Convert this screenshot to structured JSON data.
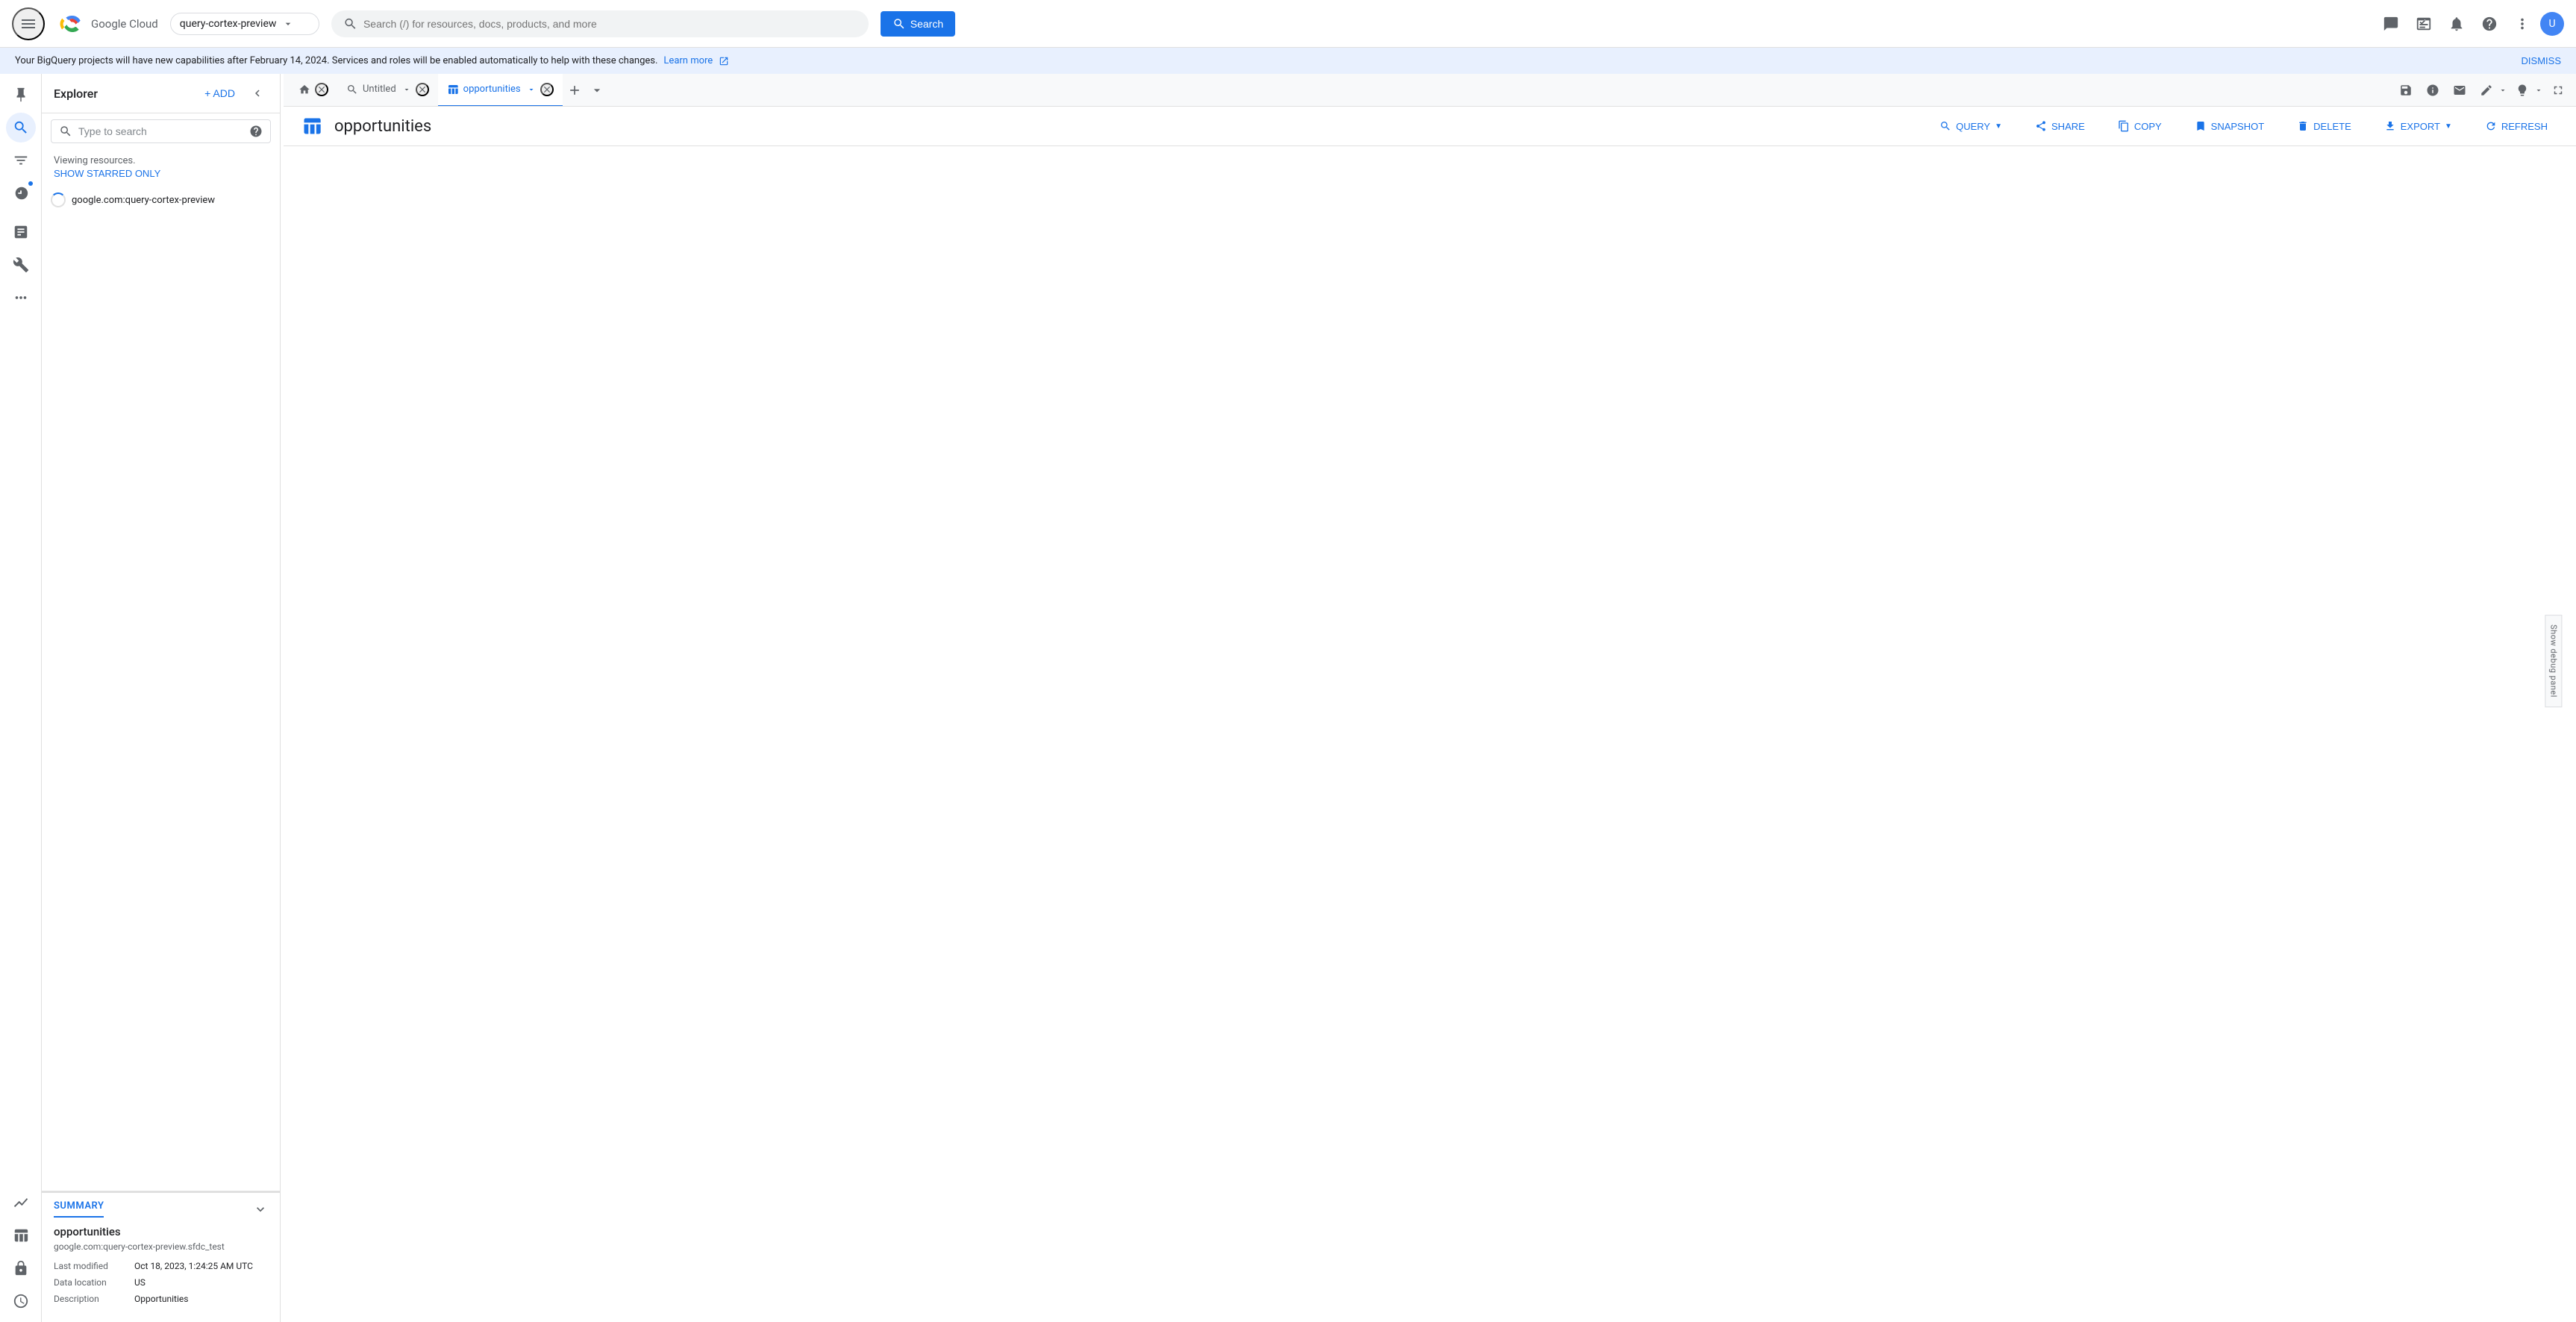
{
  "topbar": {
    "project_name": "query-cortex-preview",
    "search_placeholder": "Search (/) for resources, docs, products, and more",
    "search_button_label": "Search"
  },
  "notification": {
    "message": "Your BigQuery projects will have new capabilities after February 14, 2024. Services and roles will be enabled automatically to help with these changes.",
    "link_text": "Learn more",
    "dismiss_label": "DISMISS"
  },
  "explorer": {
    "title": "Explorer",
    "add_label": "+ ADD",
    "search_placeholder": "Type to search",
    "viewing_resources": "Viewing resources.",
    "show_starred_label": "SHOW STARRED ONLY",
    "resource_name": "google.com:query-cortex-preview"
  },
  "summary": {
    "tab_label": "SUMMARY",
    "table_name": "opportunities",
    "table_path": "google.com:query-cortex-preview.sfdc_test",
    "last_modified_label": "Last modified",
    "last_modified_value": "Oct 18, 2023, 1:24:25 AM UTC",
    "data_location_label": "Data location",
    "data_location_value": "US",
    "description_label": "Description",
    "description_value": "Opportunities"
  },
  "tabs": [
    {
      "id": "home",
      "label": "",
      "type": "home",
      "active": false,
      "closeable": true
    },
    {
      "id": "untitled",
      "label": "Untitled",
      "type": "query",
      "active": false,
      "closeable": true
    },
    {
      "id": "opportunities",
      "label": "opportunities",
      "type": "table",
      "active": true,
      "closeable": true
    }
  ],
  "content": {
    "title": "opportunities",
    "actions": [
      {
        "id": "query",
        "label": "QUERY",
        "has_dropdown": true
      },
      {
        "id": "share",
        "label": "SHARE",
        "has_dropdown": false
      },
      {
        "id": "copy",
        "label": "COPY",
        "has_dropdown": false
      },
      {
        "id": "snapshot",
        "label": "SNAPSHOT",
        "has_dropdown": false
      },
      {
        "id": "delete",
        "label": "DELETE",
        "has_dropdown": false
      },
      {
        "id": "export",
        "label": "EXPORT",
        "has_dropdown": true
      }
    ],
    "refresh_label": "REFRESH"
  },
  "debug_panel": {
    "label": "Show debug panel"
  }
}
